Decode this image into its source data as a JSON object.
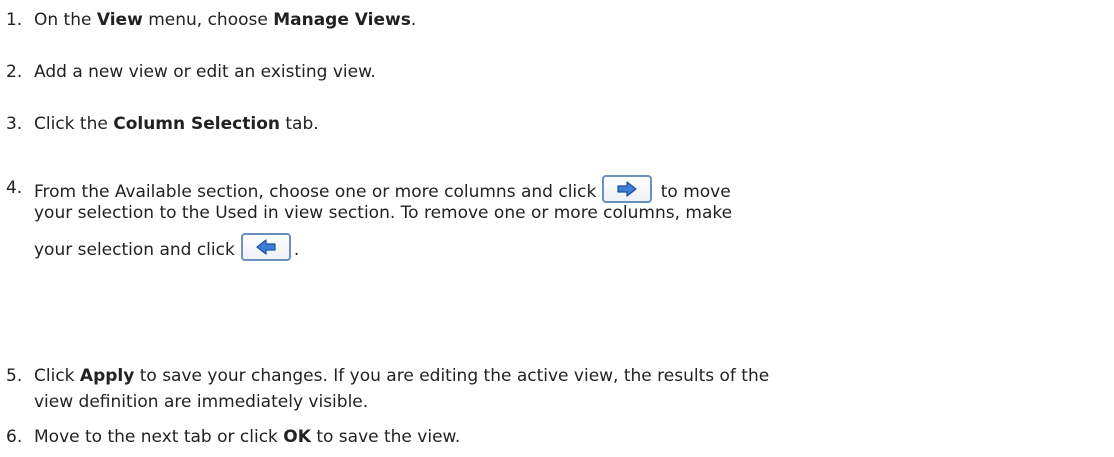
{
  "steps": [
    {
      "number": "1.",
      "parts": [
        "On the ",
        "View",
        " menu, choose ",
        "Manage Views",
        "."
      ]
    },
    {
      "number": "2.",
      "text": "Add a new view or edit an existing view."
    },
    {
      "number": "3.",
      "parts": [
        "Click the ",
        "Column Selection",
        " tab."
      ]
    },
    {
      "number": "4.",
      "line1_before": "From the Available section, choose one or more columns and click",
      "line1_after": " to move",
      "line2": "your selection to the Used in view section. To remove one or more columns, make",
      "line3_before": "your selection and click",
      "line3_after": ".",
      "add_icon": "arrow-right-icon",
      "remove_icon": "arrow-left-icon"
    },
    {
      "number": "5.",
      "line1_parts": [
        "Click ",
        "Apply",
        " to save your changes. If you are editing the active view, the results of the"
      ],
      "line2": "view definition are immediately visible."
    },
    {
      "number": "6.",
      "parts": [
        "Move to the next tab or click ",
        "OK",
        " to save the view."
      ]
    }
  ],
  "colors": {
    "text": "#222222",
    "button_border": "#6c8fc2",
    "arrow_fill": "#3d7fd6"
  }
}
